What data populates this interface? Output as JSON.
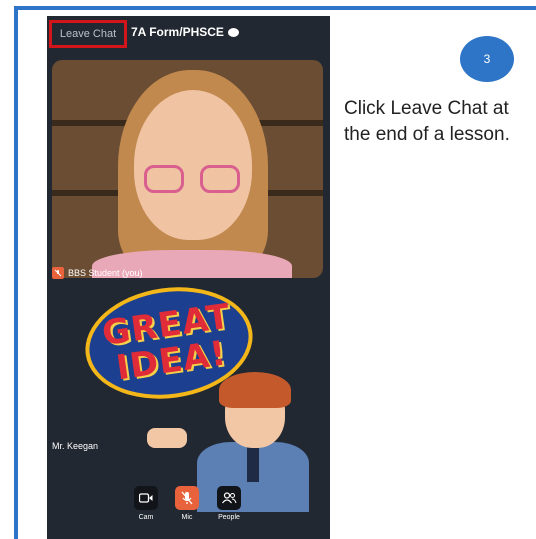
{
  "header": {
    "leave_chat_label": "Leave Chat",
    "chat_title": "7A Form/PHSCE"
  },
  "participants": {
    "self_name": "BBS Student (you)",
    "teacher_name": "Mr. Keegan"
  },
  "sticker": {
    "line1": "GREAT",
    "line2": "IDEA!"
  },
  "controls": {
    "cam_label": "Cam",
    "mic_label": "Mic",
    "people_label": "People"
  },
  "step": {
    "number": "3",
    "instruction": "Click Leave Chat at the end of a lesson."
  },
  "colors": {
    "frame": "#2e75c7",
    "highlight": "#d3141b",
    "mic_muted": "#e8623b",
    "app_background": "#222831"
  }
}
